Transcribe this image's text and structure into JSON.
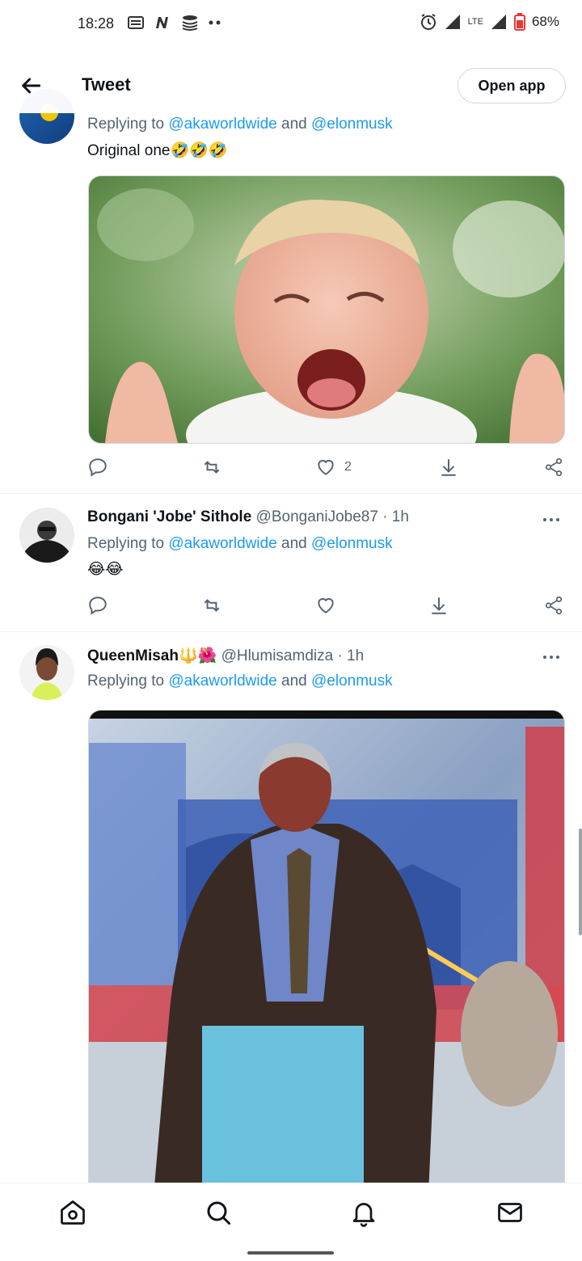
{
  "status_bar": {
    "time": "18:28",
    "battery": "68%",
    "network": "LTE",
    "icons": [
      "email-icon",
      "n-app-icon",
      "stack-icon",
      "more-dots-icon",
      "alarm-icon",
      "signal-icon",
      "battery-icon"
    ]
  },
  "header": {
    "title": "Tweet",
    "open_app_label": "Open app",
    "back_icon": "back-arrow-icon"
  },
  "tweets": [
    {
      "replying_prefix": "Replying to ",
      "mention1": "@akaworldwide",
      "joiner": " and ",
      "mention2": "@elonmusk",
      "text": "Original one🤣🤣🤣",
      "likes": "2"
    },
    {
      "name": "Bongani 'Jobe' Sithole",
      "handle_time": " @BonganiJobe87 · 1h",
      "replying_prefix": "Replying to ",
      "mention1": "@akaworldwide",
      "joiner": " and ",
      "mention2": "@elonmusk",
      "text": "😂😂"
    },
    {
      "name": "QueenMisah🔱🌺",
      "handle_time": " @Hlumisamdiza · 1h",
      "replying_prefix": "Replying to ",
      "mention1": "@akaworldwide",
      "joiner": " and ",
      "mention2": "@elonmusk"
    }
  ],
  "bottom_nav": [
    "home-icon",
    "search-icon",
    "notifications-icon",
    "messages-icon"
  ],
  "colors": {
    "accent": "#1d9bf0",
    "secondary_text": "#536471",
    "divider": "#eff3f4"
  }
}
